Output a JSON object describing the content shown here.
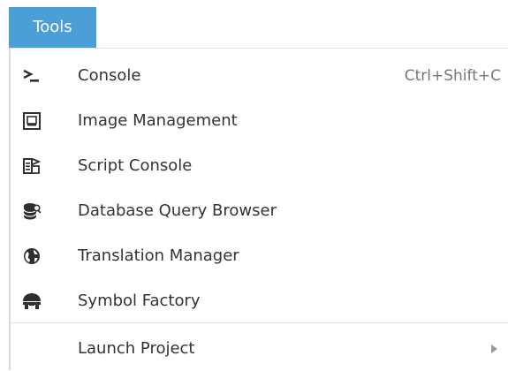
{
  "menubar": {
    "active_menu_label": "Tools"
  },
  "menu": {
    "items": [
      {
        "label": "Console",
        "shortcut": "Ctrl+Shift+C",
        "icon": "terminal-prompt-icon"
      },
      {
        "label": "Image Management",
        "icon": "image-frame-icon"
      },
      {
        "label": "Script Console",
        "icon": "script-arrow-icon"
      },
      {
        "label": "Database Query Browser",
        "icon": "database-search-icon"
      },
      {
        "label": "Translation Manager",
        "icon": "globe-icon"
      },
      {
        "label": "Symbol Factory",
        "icon": "symbol-factory-icon"
      }
    ],
    "launch": {
      "label": "Launch Project",
      "has_submenu": true
    }
  },
  "colors": {
    "accent": "#4a9fd6",
    "text": "#333333",
    "shortcut_text": "#777777",
    "icon": "#2f2f2f"
  }
}
